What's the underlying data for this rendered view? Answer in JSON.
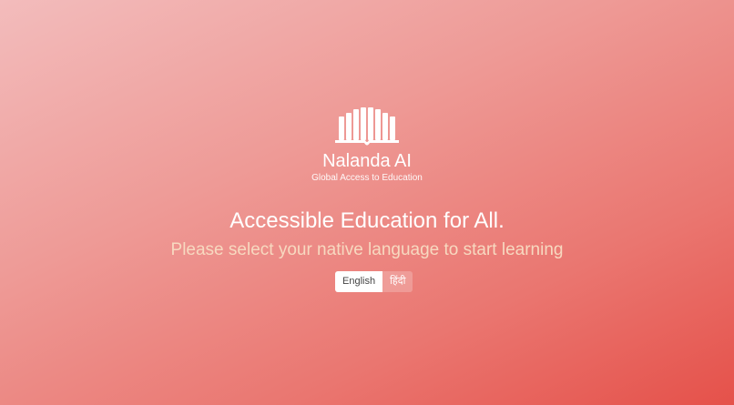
{
  "brand": {
    "logo_icon": "open-book-icon",
    "name": "Nalanda AI",
    "tagline": "Global Access to Education"
  },
  "hero": {
    "headline": "Accessible Education for All.",
    "subheadline": "Please select your native language to start learning"
  },
  "language_selector": {
    "options": [
      {
        "label": "English",
        "selected": true
      },
      {
        "label": "हिंदी",
        "selected": false
      }
    ]
  },
  "colors": {
    "background_gradient": [
      "#f3bcbc",
      "#e5514a"
    ],
    "headline": "#ffffff",
    "subheadline": "#f7d9c0"
  }
}
